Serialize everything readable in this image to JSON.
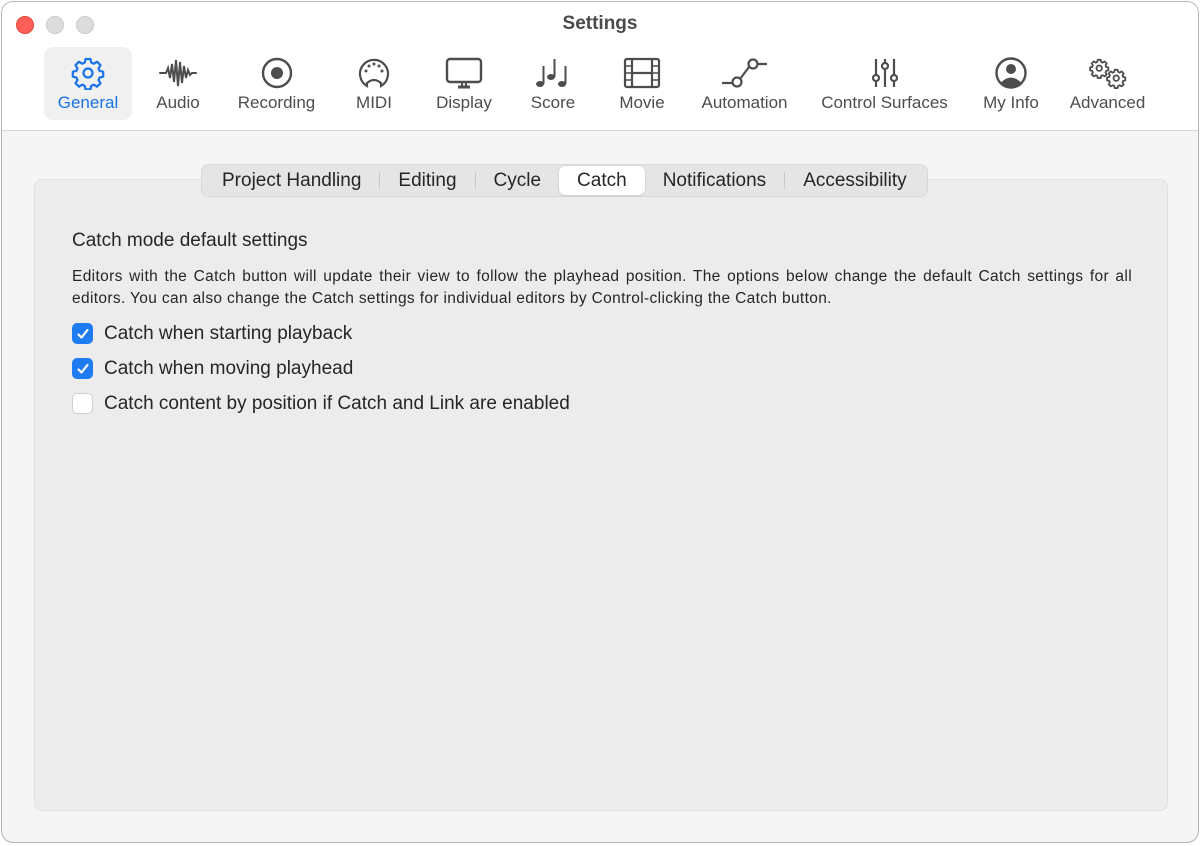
{
  "window": {
    "title": "Settings"
  },
  "toolbar": {
    "items": [
      {
        "label": "General",
        "icon": "gear-icon",
        "active": true
      },
      {
        "label": "Audio",
        "icon": "waveform-icon",
        "active": false
      },
      {
        "label": "Recording",
        "icon": "record-icon",
        "active": false
      },
      {
        "label": "MIDI",
        "icon": "midi-connector-icon",
        "active": false
      },
      {
        "label": "Display",
        "icon": "monitor-icon",
        "active": false
      },
      {
        "label": "Score",
        "icon": "music-notes-icon",
        "active": false
      },
      {
        "label": "Movie",
        "icon": "film-icon",
        "active": false
      },
      {
        "label": "Automation",
        "icon": "automation-curve-icon",
        "active": false
      },
      {
        "label": "Control Surfaces",
        "icon": "sliders-icon",
        "active": false
      },
      {
        "label": "My Info",
        "icon": "person-circle-icon",
        "active": false
      },
      {
        "label": "Advanced",
        "icon": "gears-icon",
        "active": false
      }
    ]
  },
  "tabs": [
    {
      "label": "Project Handling",
      "active": false
    },
    {
      "label": "Editing",
      "active": false
    },
    {
      "label": "Cycle",
      "active": false
    },
    {
      "label": "Catch",
      "active": true
    },
    {
      "label": "Notifications",
      "active": false
    },
    {
      "label": "Accessibility",
      "active": false
    }
  ],
  "catch": {
    "heading": "Catch mode default settings",
    "description": "Editors with the Catch button will update their view to follow the playhead position. The options below change the default Catch settings for all editors. You can also change the Catch settings for individual editors by Control-clicking the Catch button.",
    "options": [
      {
        "label": "Catch when starting playback",
        "checked": true
      },
      {
        "label": "Catch when moving playhead",
        "checked": true
      },
      {
        "label": "Catch content by position if Catch and Link are enabled",
        "checked": false
      }
    ]
  },
  "colors": {
    "accent": "#1f7bf2",
    "close": "#ff5f57"
  }
}
